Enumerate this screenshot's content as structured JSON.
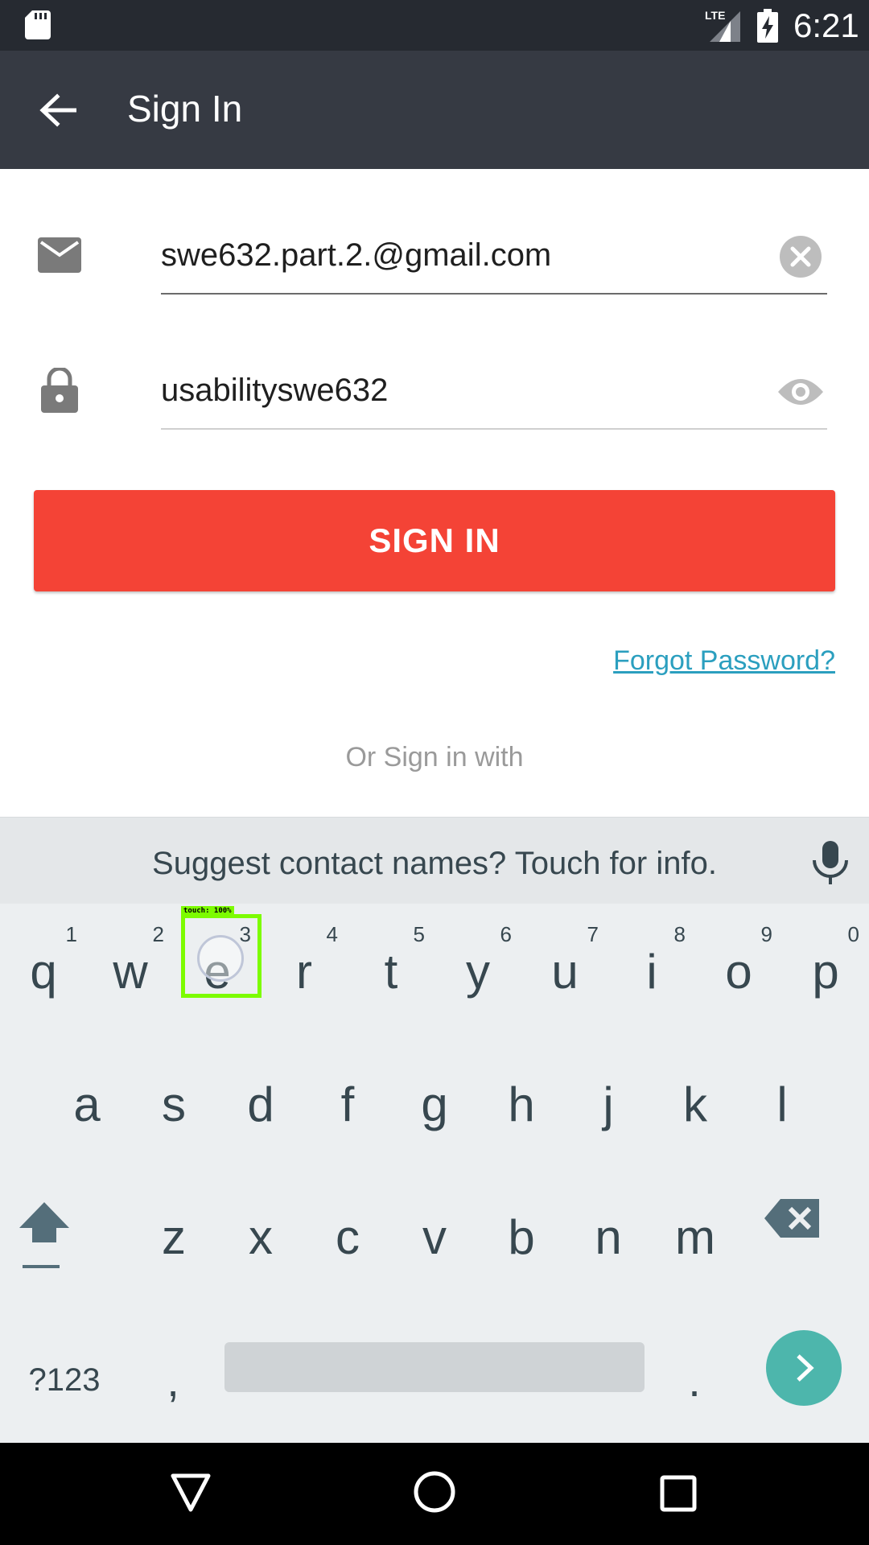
{
  "status_bar": {
    "time": "6:21",
    "network_label": "LTE",
    "icons": [
      "sd-card-icon",
      "lte-signal-icon",
      "battery-charging-icon"
    ]
  },
  "app_bar": {
    "title": "Sign In",
    "back_icon": "arrow-back-icon"
  },
  "form": {
    "email": {
      "value": "swe632.part.2.@gmail.com",
      "icon": "mail-icon",
      "trailing_icon": "clear-icon"
    },
    "password": {
      "value": "usabilityswe632",
      "icon": "lock-icon",
      "trailing_icon": "visibility-icon"
    },
    "sign_in_label": "SIGN IN",
    "forgot_password_label": "Forgot Password?",
    "or_sign_in_with": "Or Sign in with"
  },
  "colors": {
    "primary_button": "#f44336",
    "app_bar": "#363a43",
    "status_bar": "#262a31",
    "link": "#2b9fbf",
    "enter_key": "#4db6ac",
    "touch_overlay": "#7cfc00"
  },
  "keyboard": {
    "suggestion": "Suggest contact names? Touch for info.",
    "mic_icon": "microphone-icon",
    "rows": [
      [
        {
          "char": "q",
          "hint": "1"
        },
        {
          "char": "w",
          "hint": "2"
        },
        {
          "char": "e",
          "hint": "3"
        },
        {
          "char": "r",
          "hint": "4"
        },
        {
          "char": "t",
          "hint": "5"
        },
        {
          "char": "y",
          "hint": "6"
        },
        {
          "char": "u",
          "hint": "7"
        },
        {
          "char": "i",
          "hint": "8"
        },
        {
          "char": "o",
          "hint": "9"
        },
        {
          "char": "p",
          "hint": "0"
        }
      ],
      [
        {
          "char": "a"
        },
        {
          "char": "s"
        },
        {
          "char": "d"
        },
        {
          "char": "f"
        },
        {
          "char": "g"
        },
        {
          "char": "h"
        },
        {
          "char": "j"
        },
        {
          "char": "k"
        },
        {
          "char": "l"
        }
      ],
      [
        {
          "char": "z"
        },
        {
          "char": "x"
        },
        {
          "char": "c"
        },
        {
          "char": "v"
        },
        {
          "char": "b"
        },
        {
          "char": "n"
        },
        {
          "char": "m"
        }
      ]
    ],
    "symbols_label": "?123",
    "comma_label": ",",
    "period_label": ".",
    "shift_icon": "shift-icon",
    "backspace_icon": "backspace-icon",
    "enter_icon": "chevron-right-icon"
  },
  "touch_overlay": {
    "label": "touch: 100%"
  },
  "nav_bar": {
    "icons": [
      "nav-back-icon",
      "nav-home-icon",
      "nav-recents-icon"
    ]
  }
}
